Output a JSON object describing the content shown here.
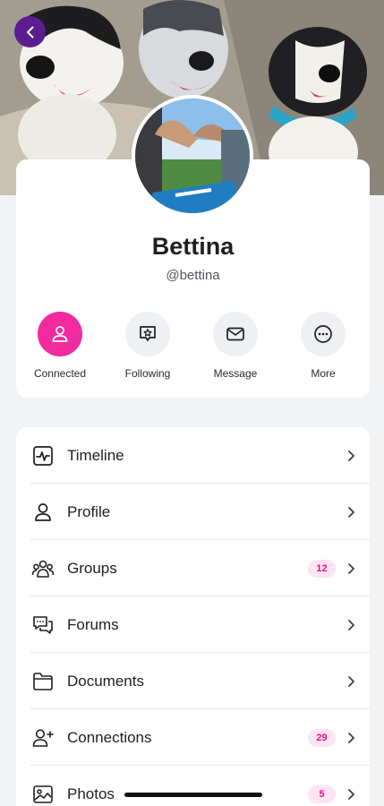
{
  "header": {
    "cover_alt": "Cover photo of three dogs",
    "back_icon": "chevron-left-icon",
    "accent": "#5b1d8f"
  },
  "profile": {
    "name": "Bettina",
    "handle": "@bettina"
  },
  "actions": [
    {
      "label": "Connected",
      "icon": "person-icon",
      "active": true
    },
    {
      "label": "Following",
      "icon": "star-bubble-icon",
      "active": false
    },
    {
      "label": "Message",
      "icon": "envelope-icon",
      "active": false
    },
    {
      "label": "More",
      "icon": "more-icon",
      "active": false
    }
  ],
  "menu": [
    {
      "label": "Timeline",
      "icon": "activity-icon",
      "badge": ""
    },
    {
      "label": "Profile",
      "icon": "person-icon",
      "badge": ""
    },
    {
      "label": "Groups",
      "icon": "group-icon",
      "badge": "12"
    },
    {
      "label": "Forums",
      "icon": "forum-icon",
      "badge": ""
    },
    {
      "label": "Documents",
      "icon": "folder-icon",
      "badge": ""
    },
    {
      "label": "Connections",
      "icon": "add-person-icon",
      "badge": "29"
    },
    {
      "label": "Photos",
      "icon": "photo-icon",
      "badge": "5"
    }
  ],
  "colors": {
    "brand_pink": "#f12aa0",
    "badge_bg": "#fde4f2",
    "badge_text": "#e0148a"
  }
}
